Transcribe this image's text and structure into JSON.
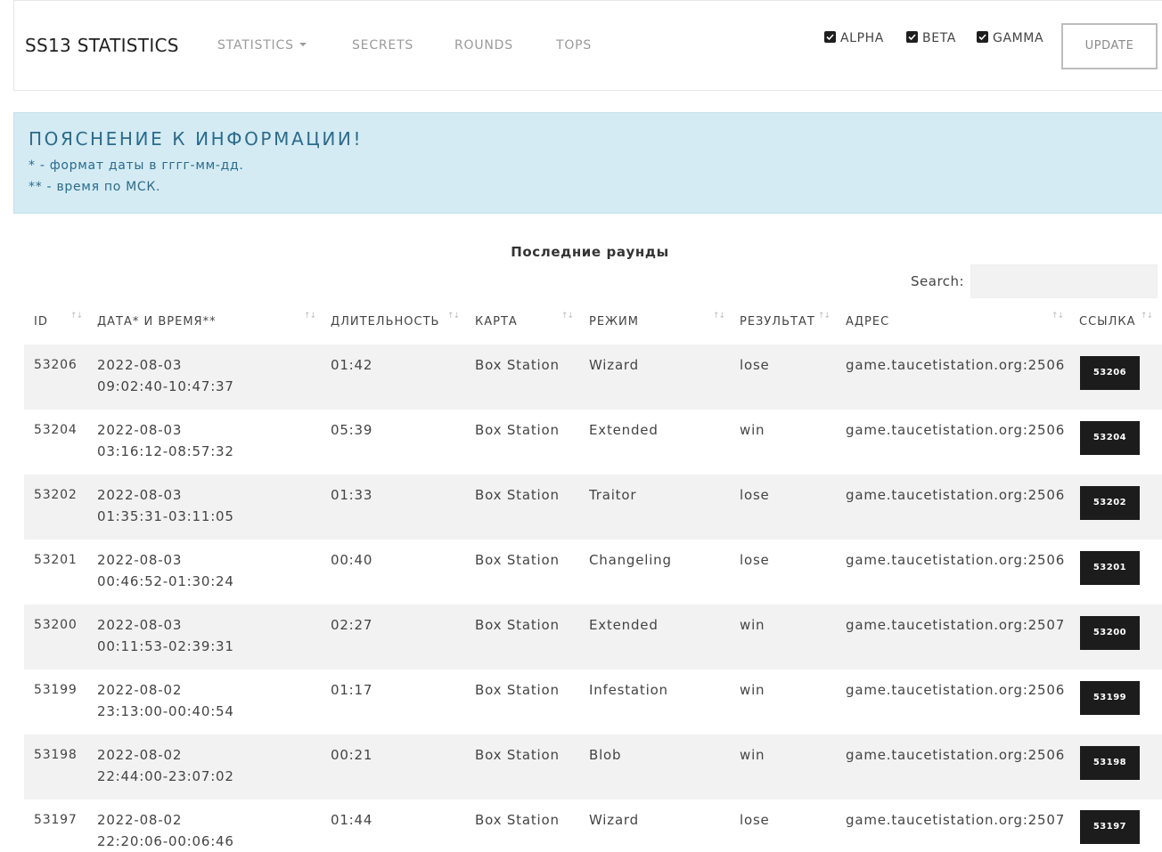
{
  "navbar": {
    "brand": "SS13 STATISTICS",
    "links": [
      {
        "label": "STATISTICS"
      },
      {
        "label": "SECRETS"
      },
      {
        "label": "ROUNDS"
      },
      {
        "label": "TOPS"
      }
    ],
    "servers": [
      {
        "label": "ALPHA",
        "checked": true
      },
      {
        "label": "BETA",
        "checked": true
      },
      {
        "label": "GAMMA",
        "checked": true
      }
    ],
    "update_label": "UPDATE"
  },
  "alert": {
    "title": "ПОЯСНЕНИЕ К ИНФОРМАЦИИ!",
    "line1": "* - формат даты в гггг-мм-дд.",
    "line2": "** - время по МСК."
  },
  "table": {
    "caption": "Последние раунды",
    "search_label": "Search:",
    "search_value": "",
    "columns": [
      "ID",
      "ДАТА* И ВРЕМЯ**",
      "ДЛИТЕЛЬНОСТЬ",
      "КАРТА",
      "РЕЖИМ",
      "РЕЗУЛЬТАТ",
      "АДРЕС",
      "ССЫЛКА"
    ],
    "rows": [
      {
        "id": "53206",
        "date": "2022-08-03",
        "time": "09:02:40-10:47:37",
        "duration": "01:42",
        "map": "Box Station",
        "mode": "Wizard",
        "result": "lose",
        "address": "game.taucetistation.org:2506",
        "link": "53206"
      },
      {
        "id": "53204",
        "date": "2022-08-03",
        "time": "03:16:12-08:57:32",
        "duration": "05:39",
        "map": "Box Station",
        "mode": "Extended",
        "result": "win",
        "address": "game.taucetistation.org:2506",
        "link": "53204"
      },
      {
        "id": "53202",
        "date": "2022-08-03",
        "time": "01:35:31-03:11:05",
        "duration": "01:33",
        "map": "Box Station",
        "mode": "Traitor",
        "result": "lose",
        "address": "game.taucetistation.org:2506",
        "link": "53202"
      },
      {
        "id": "53201",
        "date": "2022-08-03",
        "time": "00:46:52-01:30:24",
        "duration": "00:40",
        "map": "Box Station",
        "mode": "Changeling",
        "result": "lose",
        "address": "game.taucetistation.org:2506",
        "link": "53201"
      },
      {
        "id": "53200",
        "date": "2022-08-03",
        "time": "00:11:53-02:39:31",
        "duration": "02:27",
        "map": "Box Station",
        "mode": "Extended",
        "result": "win",
        "address": "game.taucetistation.org:2507",
        "link": "53200"
      },
      {
        "id": "53199",
        "date": "2022-08-02",
        "time": "23:13:00-00:40:54",
        "duration": "01:17",
        "map": "Box Station",
        "mode": "Infestation",
        "result": "win",
        "address": "game.taucetistation.org:2506",
        "link": "53199"
      },
      {
        "id": "53198",
        "date": "2022-08-02",
        "time": "22:44:00-23:07:02",
        "duration": "00:21",
        "map": "Box Station",
        "mode": "Blob",
        "result": "win",
        "address": "game.taucetistation.org:2506",
        "link": "53198"
      },
      {
        "id": "53197",
        "date": "2022-08-02",
        "time": "22:20:06-00:06:46",
        "duration": "01:44",
        "map": "Box Station",
        "mode": "Wizard",
        "result": "lose",
        "address": "game.taucetistation.org:2507",
        "link": "53197"
      }
    ]
  }
}
